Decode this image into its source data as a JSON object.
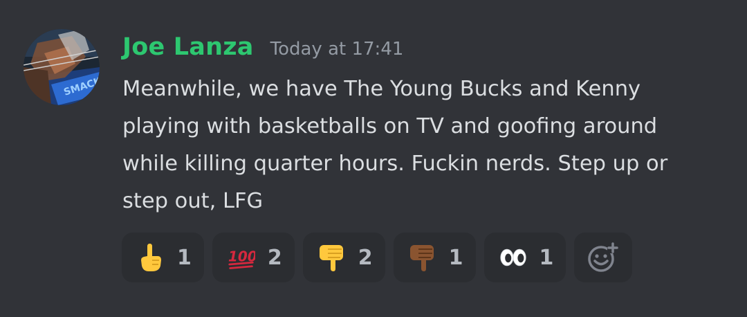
{
  "message": {
    "author": "Joe Lanza",
    "timestamp": "Today at 17:41",
    "lines": [
      "Meanwhile, we have The Young Bucks and Kenny",
      "playing with basketballs on TV and goofing around",
      "while killing quarter hours. Fuckin nerds. Step up or",
      "step out, LFG"
    ]
  },
  "reactions": [
    {
      "emoji": "pointing-up-hand-icon",
      "count": "1"
    },
    {
      "emoji": "hundred-points-icon",
      "count": "2"
    },
    {
      "emoji": "thumbs-down-icon",
      "count": "2"
    },
    {
      "emoji": "thumbs-down-dark-skin-icon",
      "count": "1"
    },
    {
      "emoji": "eyes-icon",
      "count": "1"
    }
  ],
  "colors": {
    "background": "#313338",
    "username": "#2dc770",
    "timestamp": "#949ba4",
    "text": "#dbdee1",
    "reaction_bg": "#2b2d31",
    "reaction_count": "#b5bac1"
  }
}
